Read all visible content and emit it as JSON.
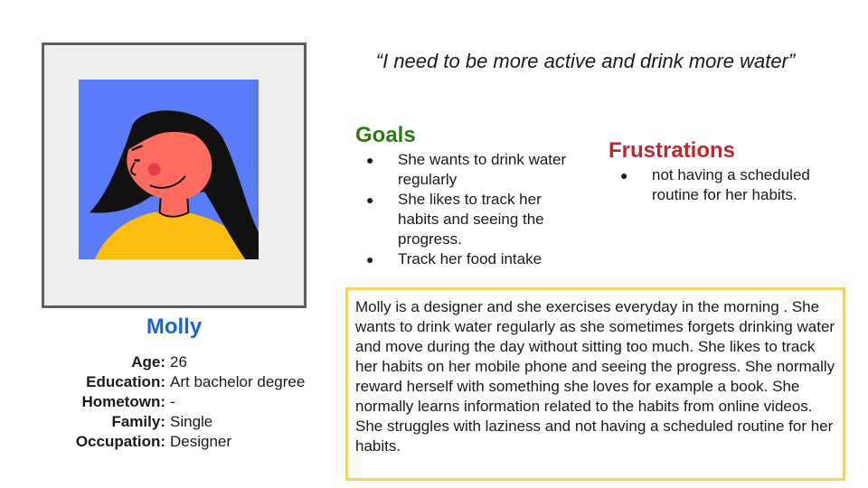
{
  "persona": {
    "name": "Molly",
    "details": [
      {
        "label": "Age:",
        "value": "26"
      },
      {
        "label": "Education:",
        "value": "Art bachelor degree"
      },
      {
        "label": "Hometown:",
        "value": "-"
      },
      {
        "label": "Family:",
        "value": "Single"
      },
      {
        "label": "Occupation:",
        "value": "Designer"
      }
    ]
  },
  "quote": "“I need to be more active and drink more water”",
  "goals": {
    "title": "Goals",
    "items": [
      "She wants to drink water regularly",
      "She likes to track her habits and seeing the progress.",
      "Track her food intake"
    ]
  },
  "frustrations": {
    "title": "Frustrations",
    "items": [
      "not having a scheduled routine for her habits."
    ]
  },
  "bio": "Molly is a designer and she exercises everyday in the morning . She wants to drink water regularly as she sometimes forgets drinking water and move during the day without sitting too much. She likes to track her habits on her mobile phone and seeing the progress. She normally reward herself with something she loves for example a book. She normally learns information related to the habits from online videos. She struggles with laziness and not having a scheduled routine for her habits.",
  "colors": {
    "name": "#1a66cc",
    "goals": "#2d7a14",
    "frustrations": "#c0272d",
    "bio_border": "#f6d167",
    "avatar_bg": "#5b7cf8",
    "skin": "#ff6d61",
    "shirt": "#fbbd0f"
  },
  "bullet_symbol": "●"
}
